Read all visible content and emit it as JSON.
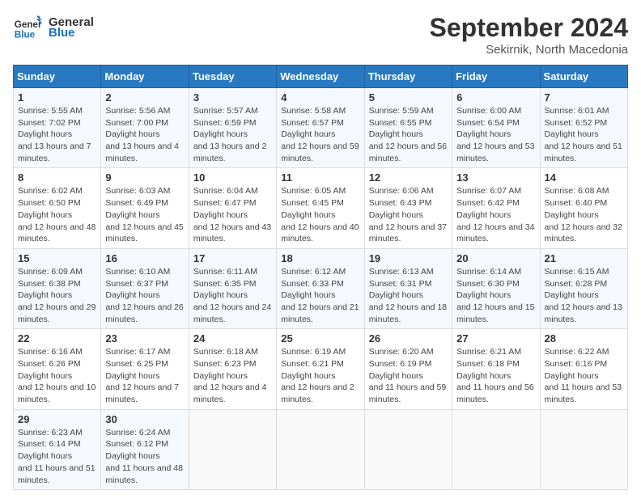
{
  "header": {
    "logo_line1": "General",
    "logo_line2": "Blue",
    "month_title": "September 2024",
    "location": "Sekirnik, North Macedonia"
  },
  "weekdays": [
    "Sunday",
    "Monday",
    "Tuesday",
    "Wednesday",
    "Thursday",
    "Friday",
    "Saturday"
  ],
  "weeks": [
    [
      {
        "day": "1",
        "sunrise": "5:55 AM",
        "sunset": "7:02 PM",
        "daylight": "13 hours and 7 minutes."
      },
      {
        "day": "2",
        "sunrise": "5:56 AM",
        "sunset": "7:00 PM",
        "daylight": "13 hours and 4 minutes."
      },
      {
        "day": "3",
        "sunrise": "5:57 AM",
        "sunset": "6:59 PM",
        "daylight": "13 hours and 2 minutes."
      },
      {
        "day": "4",
        "sunrise": "5:58 AM",
        "sunset": "6:57 PM",
        "daylight": "12 hours and 59 minutes."
      },
      {
        "day": "5",
        "sunrise": "5:59 AM",
        "sunset": "6:55 PM",
        "daylight": "12 hours and 56 minutes."
      },
      {
        "day": "6",
        "sunrise": "6:00 AM",
        "sunset": "6:54 PM",
        "daylight": "12 hours and 53 minutes."
      },
      {
        "day": "7",
        "sunrise": "6:01 AM",
        "sunset": "6:52 PM",
        "daylight": "12 hours and 51 minutes."
      }
    ],
    [
      {
        "day": "8",
        "sunrise": "6:02 AM",
        "sunset": "6:50 PM",
        "daylight": "12 hours and 48 minutes."
      },
      {
        "day": "9",
        "sunrise": "6:03 AM",
        "sunset": "6:49 PM",
        "daylight": "12 hours and 45 minutes."
      },
      {
        "day": "10",
        "sunrise": "6:04 AM",
        "sunset": "6:47 PM",
        "daylight": "12 hours and 43 minutes."
      },
      {
        "day": "11",
        "sunrise": "6:05 AM",
        "sunset": "6:45 PM",
        "daylight": "12 hours and 40 minutes."
      },
      {
        "day": "12",
        "sunrise": "6:06 AM",
        "sunset": "6:43 PM",
        "daylight": "12 hours and 37 minutes."
      },
      {
        "day": "13",
        "sunrise": "6:07 AM",
        "sunset": "6:42 PM",
        "daylight": "12 hours and 34 minutes."
      },
      {
        "day": "14",
        "sunrise": "6:08 AM",
        "sunset": "6:40 PM",
        "daylight": "12 hours and 32 minutes."
      }
    ],
    [
      {
        "day": "15",
        "sunrise": "6:09 AM",
        "sunset": "6:38 PM",
        "daylight": "12 hours and 29 minutes."
      },
      {
        "day": "16",
        "sunrise": "6:10 AM",
        "sunset": "6:37 PM",
        "daylight": "12 hours and 26 minutes."
      },
      {
        "day": "17",
        "sunrise": "6:11 AM",
        "sunset": "6:35 PM",
        "daylight": "12 hours and 24 minutes."
      },
      {
        "day": "18",
        "sunrise": "6:12 AM",
        "sunset": "6:33 PM",
        "daylight": "12 hours and 21 minutes."
      },
      {
        "day": "19",
        "sunrise": "6:13 AM",
        "sunset": "6:31 PM",
        "daylight": "12 hours and 18 minutes."
      },
      {
        "day": "20",
        "sunrise": "6:14 AM",
        "sunset": "6:30 PM",
        "daylight": "12 hours and 15 minutes."
      },
      {
        "day": "21",
        "sunrise": "6:15 AM",
        "sunset": "6:28 PM",
        "daylight": "12 hours and 13 minutes."
      }
    ],
    [
      {
        "day": "22",
        "sunrise": "6:16 AM",
        "sunset": "6:26 PM",
        "daylight": "12 hours and 10 minutes."
      },
      {
        "day": "23",
        "sunrise": "6:17 AM",
        "sunset": "6:25 PM",
        "daylight": "12 hours and 7 minutes."
      },
      {
        "day": "24",
        "sunrise": "6:18 AM",
        "sunset": "6:23 PM",
        "daylight": "12 hours and 4 minutes."
      },
      {
        "day": "25",
        "sunrise": "6:19 AM",
        "sunset": "6:21 PM",
        "daylight": "12 hours and 2 minutes."
      },
      {
        "day": "26",
        "sunrise": "6:20 AM",
        "sunset": "6:19 PM",
        "daylight": "11 hours and 59 minutes."
      },
      {
        "day": "27",
        "sunrise": "6:21 AM",
        "sunset": "6:18 PM",
        "daylight": "11 hours and 56 minutes."
      },
      {
        "day": "28",
        "sunrise": "6:22 AM",
        "sunset": "6:16 PM",
        "daylight": "11 hours and 53 minutes."
      }
    ],
    [
      {
        "day": "29",
        "sunrise": "6:23 AM",
        "sunset": "6:14 PM",
        "daylight": "11 hours and 51 minutes."
      },
      {
        "day": "30",
        "sunrise": "6:24 AM",
        "sunset": "6:12 PM",
        "daylight": "11 hours and 48 minutes."
      },
      null,
      null,
      null,
      null,
      null
    ]
  ],
  "labels": {
    "sunrise": "Sunrise:",
    "sunset": "Sunset:",
    "daylight": "Daylight hours"
  }
}
